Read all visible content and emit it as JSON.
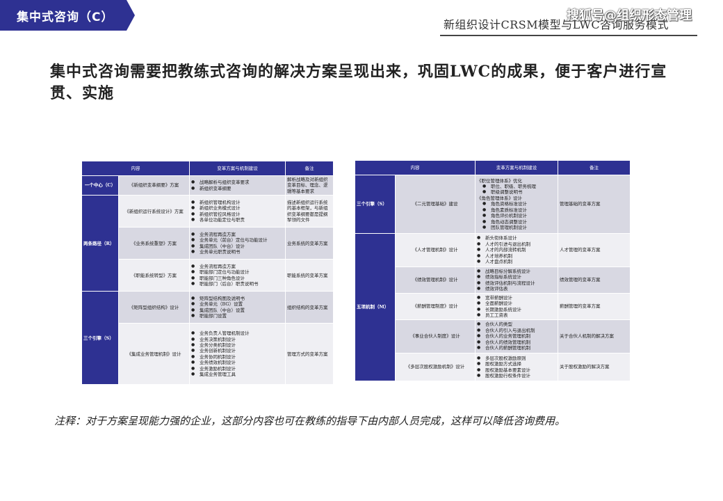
{
  "header": {
    "tag_label": "集中式咨询（C）",
    "title": "新组织设计CRSM模型与LWC咨询服务模式",
    "watermark": "搜狐号@组织形态管理",
    "accent": "#2e3192"
  },
  "heading": "集中式咨询需要把教练式咨询的解决方案呈现出来，巩固LWC的成果，便于客户进行宣贯、实施",
  "left_table": {
    "headers": [
      "内容",
      "变革方案与机制建设",
      "备注"
    ],
    "groups": [
      "一个中心（C）",
      "两条路径（R）",
      "三个引擎（S）"
    ],
    "rows": [
      {
        "content": "《新组织变革纲要》方案",
        "items": [
          "战略解析与组织变革要求",
          "新组织变革纲要"
        ],
        "note": "解析战略及对新组织变革目标、理念、逻辑等基本要求"
      },
      {
        "content": "《新组织运行系统设计》方案",
        "items": [
          "新组织管理机构设计",
          "新组织业务模式设计",
          "新组织管控风格设计",
          "各单位功能定位与职责"
        ],
        "note": "描述新组织运行系统的基本框架，与新组织变革纲要都是提纲挈领的文件"
      },
      {
        "content": "《业务系统重塑》方案",
        "items": [
          "业务流程再造方案",
          "业务单元（前台）定位与功能设计",
          "集成团队（中台）设计",
          "业务单元职责说明书"
        ],
        "note": "业务系统的变革方案"
      },
      {
        "content": "《职能系统转型》方案",
        "items": [
          "业务流程再造方案",
          "职能部门定位与功能设计",
          "职能部门三种角色设计",
          "职能部门（后台）职责说明书"
        ],
        "note": "职能系统的变革方案"
      },
      {
        "content": "《矩阵型组织结构》设计",
        "items": [
          "矩阵型结构图及说明书",
          "业务单元（BG）设置",
          "集成团队（中台）设置",
          "职能部门设置"
        ],
        "note": "组织结构的变革方案"
      },
      {
        "content": "《集成业务管理机制》设计",
        "items": [
          "业务负责人管理机制设计",
          "业务决策机制设计",
          "业务分类机制设计",
          "业务创新机制设计",
          "业务协同机制设计",
          "业务绩效机制设计",
          "业务激励机制设计",
          "集成业务管理工具"
        ],
        "note": "管理方式的变革方案"
      }
    ]
  },
  "right_table": {
    "headers": [
      "内容",
      "变革方案与机制建设",
      "备注"
    ],
    "groups": [
      "三个引擎（S）",
      "五项机制（M）"
    ],
    "rows": [
      {
        "content": "《二元管理基础》建设",
        "items": [
          {
            "t": "《职位管理体系》优化",
            "k": "nb"
          },
          {
            "t": "职位、职级、职务梳理",
            "k": "sub"
          },
          {
            "t": "职级调整说明书",
            "k": "sub"
          },
          {
            "t": "《角色管理体系》设计",
            "k": "nb"
          },
          {
            "t": "角色资格标准设计",
            "k": "sub"
          },
          {
            "t": "角色素质标准设计",
            "k": "sub"
          },
          {
            "t": "角色评价机制设计",
            "k": "sub"
          },
          {
            "t": "角色动态调整设计",
            "k": "sub"
          },
          {
            "t": "团队管理机制设计",
            "k": "sub"
          }
        ],
        "note": "管理基础的变革方案"
      },
      {
        "content": "《人才管理机制》设计",
        "items": [
          "新头衔体系设计",
          "人才的引进与退出机制",
          "人才的内部流转机制",
          "人才培养机制",
          "人才盘点机制"
        ],
        "note": "人才管理的变革方案"
      },
      {
        "content": "《绩效管理机制》设计",
        "items": [
          "战略目标分解系统设计",
          "绩效指标系统设计",
          "绩效评估机制与流程设计",
          "绩效评估表"
        ],
        "note": "绩效管理的变革方案"
      },
      {
        "content": "《薪酬管理制度》设计",
        "items": [
          "宽带薪酬设计",
          "全面薪酬设计",
          "长期激励系统设计",
          "员工工资表"
        ],
        "note": "薪酬管理的变革方案"
      },
      {
        "content": "《事业合伙人制度》设计",
        "items": [
          "合伙人的类型",
          "合伙人的引入与退出机制",
          "合伙人的业务管理机制",
          "合伙人的绩效管理机制",
          "合伙人的薪酬管理机制"
        ],
        "note": "关于合伙人机制的解决方案"
      },
      {
        "content": "《多层次股权激励机制》设计",
        "items": [
          "多层次股权激励原则",
          "股权激励方式选择",
          "股权激励基本要素设计",
          "股权激励行权条件设计"
        ],
        "note": "关于股权激励的解决方案"
      }
    ]
  },
  "footnote": "注释：对于方案呈现能力强的企业，这部分内容也可在教练的指导下由内部人员完成，这样可以降低咨询费用。"
}
